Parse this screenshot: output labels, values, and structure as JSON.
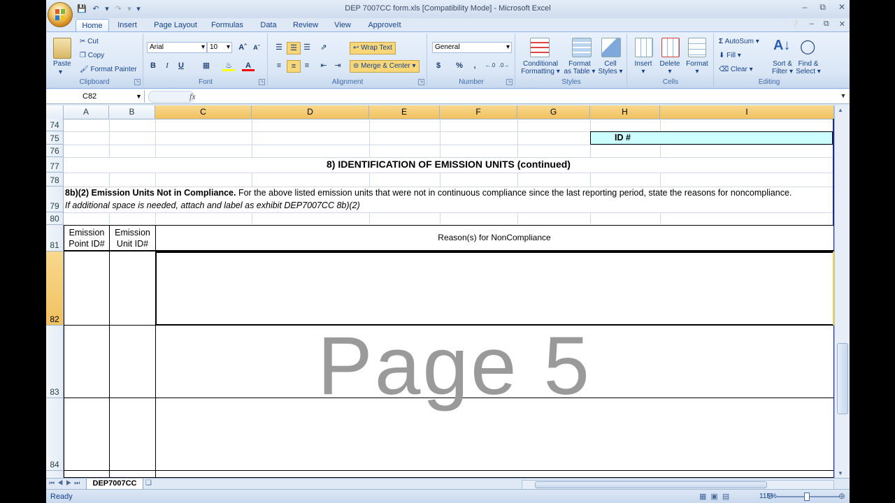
{
  "window": {
    "title": "DEP 7007CC form.xls  [Compatibility Mode] - Microsoft Excel"
  },
  "tabs": [
    "Home",
    "Insert",
    "Page Layout",
    "Formulas",
    "Data",
    "Review",
    "View",
    "ApproveIt"
  ],
  "active_tab": "Home",
  "ribbon": {
    "clipboard": {
      "label": "Clipboard",
      "paste": "Paste",
      "cut": "Cut",
      "copy": "Copy",
      "format_painter": "Format Painter"
    },
    "font": {
      "label": "Font",
      "name": "Arial",
      "size": "10",
      "bold": "B",
      "italic": "I",
      "underline": "U"
    },
    "alignment": {
      "label": "Alignment",
      "wrap_text": "Wrap Text",
      "merge_center": "Merge & Center"
    },
    "number": {
      "label": "Number",
      "format": "General",
      "currency": "$",
      "percent": "%",
      "comma": ","
    },
    "styles": {
      "label": "Styles",
      "conditional_1": "Conditional",
      "conditional_2": "Formatting",
      "format_table_1": "Format",
      "format_table_2": "as Table",
      "cell_styles_1": "Cell",
      "cell_styles_2": "Styles"
    },
    "cells": {
      "label": "Cells",
      "insert": "Insert",
      "delete": "Delete",
      "format": "Format"
    },
    "editing": {
      "label": "Editing",
      "autosum": "AutoSum",
      "fill": "Fill",
      "clear": "Clear",
      "sort_1": "Sort &",
      "sort_2": "Filter",
      "find_1": "Find &",
      "find_2": "Select"
    }
  },
  "formula_bar": {
    "name_box": "C82",
    "fx": "fx",
    "value": ""
  },
  "columns": [
    "A",
    "B",
    "C",
    "D",
    "E",
    "F",
    "G",
    "H",
    "I"
  ],
  "rows": [
    "74",
    "75",
    "76",
    "77",
    "78",
    "79",
    "80",
    "81",
    "82",
    "83",
    "84"
  ],
  "cells": {
    "id_label": "ID #",
    "section_title": "8) IDENTIFICATION OF EMISSION UNITS (continued)",
    "desc_bold": "8b)(2) Emission Units Not in Compliance.",
    "desc_text": " For the above listed emission units that were not in continuous compliance since the last reporting period, state the reasons for noncompliance.",
    "desc_italic": "If additional space is needed, attach and label as exhibit DEP7007CC 8b)(2)",
    "hdr_a_1": "Emission",
    "hdr_a_2": "Point ID#",
    "hdr_b_1": "Emission",
    "hdr_b_2": "Unit ID#",
    "hdr_reason": "Reason(s) for NonCompliance"
  },
  "watermark": "Page 5",
  "sheet_tab": "DEP7007CC",
  "status": {
    "ready": "Ready",
    "zoom": "115%"
  }
}
